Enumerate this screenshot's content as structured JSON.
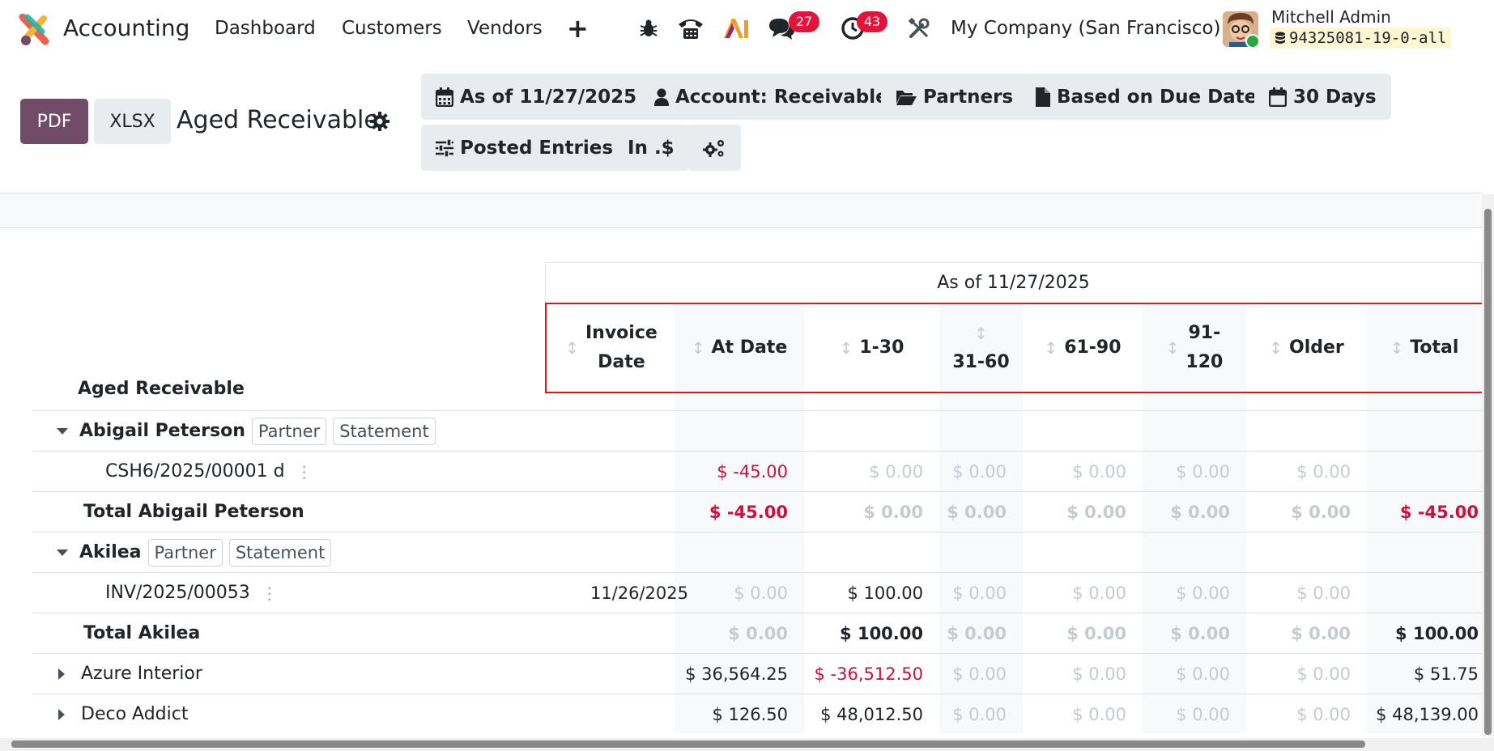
{
  "navbar": {
    "app_name": "Accounting",
    "menu": [
      "Dashboard",
      "Customers",
      "Vendors"
    ],
    "messages_badge": "27",
    "activities_badge": "43",
    "company": "My Company (San Francisco)",
    "user_name": "Mitchell Admin",
    "database": "94325081-19-0-all"
  },
  "control_panel": {
    "pdf_label": "PDF",
    "xlsx_label": "XLSX",
    "title": "Aged Receivable",
    "filters": {
      "date": "As of 11/27/2025",
      "account": "Account: Receivable",
      "partners": "Partners",
      "basis": "Based on Due Date",
      "period": "30 Days",
      "entries": "Posted Entries",
      "currency": "In .$"
    }
  },
  "report": {
    "group_header": "As of 11/27/2025",
    "label": "Aged Receivable",
    "columns": {
      "invoice_date_1": "Invoice",
      "invoice_date_2": "Date",
      "at_date": "At Date",
      "p1": "1-30",
      "p2": "31-60",
      "p3": "61-90",
      "p4_1": "91-",
      "p4_2": "120",
      "older": "Older",
      "total": "Total"
    },
    "tag_partner": "Partner",
    "tag_statement": "Statement",
    "rows": {
      "abigail": {
        "name": "Abigail Peterson"
      },
      "abigail_line": {
        "ref": "CSH6/2025/00001 d",
        "date": "",
        "at_date": "$ -45.00",
        "p1": "$ 0.00",
        "p2": "$ 0.00",
        "p3": "$ 0.00",
        "p4": "$ 0.00",
        "older": "$ 0.00",
        "total": ""
      },
      "abigail_total": {
        "name": "Total Abigail Peterson",
        "at_date": "$ -45.00",
        "p1": "$ 0.00",
        "p2": "$ 0.00",
        "p3": "$ 0.00",
        "p4": "$ 0.00",
        "older": "$ 0.00",
        "total": "$ -45.00"
      },
      "akilea": {
        "name": "Akilea"
      },
      "akilea_line": {
        "ref": "INV/2025/00053",
        "date": "11/26/2025",
        "at_date": "$ 0.00",
        "p1": "$ 100.00",
        "p2": "$ 0.00",
        "p3": "$ 0.00",
        "p4": "$ 0.00",
        "older": "$ 0.00",
        "total": ""
      },
      "akilea_total": {
        "name": "Total Akilea",
        "at_date": "$ 0.00",
        "p1": "$ 100.00",
        "p2": "$ 0.00",
        "p3": "$ 0.00",
        "p4": "$ 0.00",
        "older": "$ 0.00",
        "total": "$ 100.00"
      },
      "azure": {
        "name": "Azure Interior",
        "at_date": "$ 36,564.25",
        "p1": "$ -36,512.50",
        "p2": "$ 0.00",
        "p3": "$ 0.00",
        "p4": "$ 0.00",
        "older": "$ 0.00",
        "total": "$ 51.75"
      },
      "deco": {
        "name": "Deco Addict",
        "at_date": "$ 126.50",
        "p1": "$ 48,012.50",
        "p2": "$ 0.00",
        "p3": "$ 0.00",
        "p4": "$ 0.00",
        "older": "$ 0.00",
        "total": "$ 48,139.00"
      }
    }
  },
  "colors": {
    "brand": "#714b67",
    "negative": "#d0103a",
    "badge": "#e3143b",
    "highlight": "#e0141e"
  }
}
